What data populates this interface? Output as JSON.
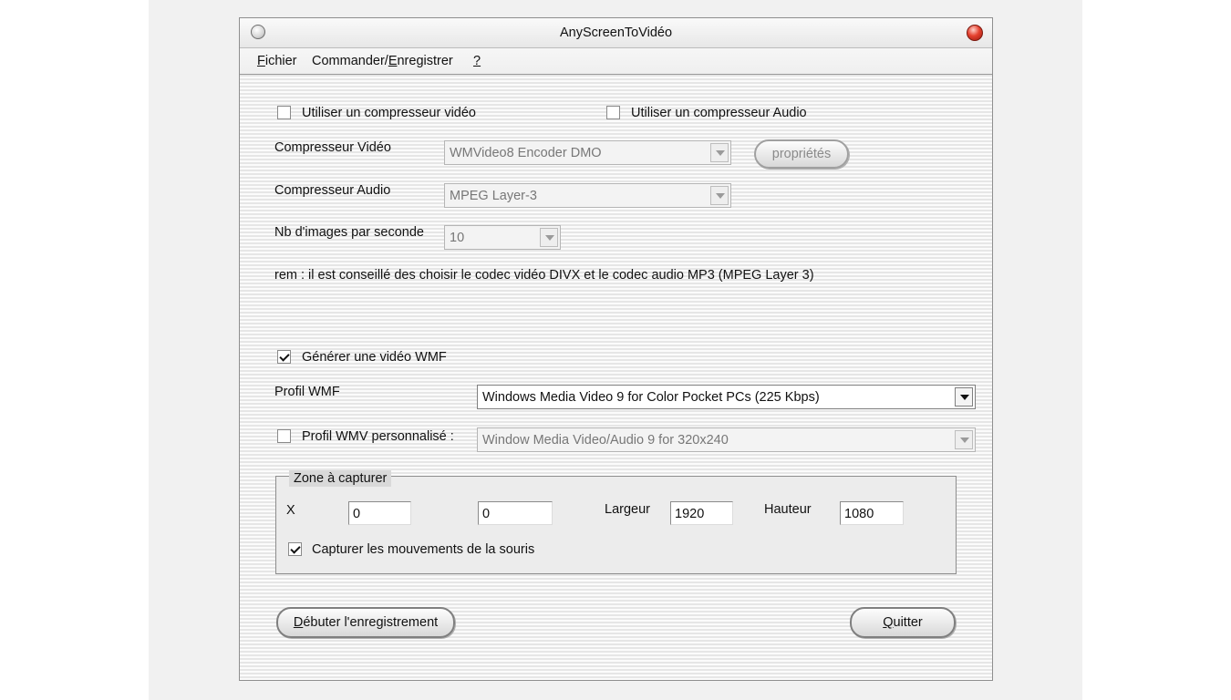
{
  "window": {
    "title": "AnyScreenToVidéo"
  },
  "menu": [
    {
      "before": "",
      "key": "F",
      "after": "ichier"
    },
    {
      "before": "Commander/",
      "key": "E",
      "after": "nregistrer"
    },
    {
      "before": "",
      "key": "?",
      "after": ""
    }
  ],
  "compression": {
    "use_video_compressor": {
      "label": "Utiliser un compresseur vidéo",
      "checked": false
    },
    "use_audio_compressor": {
      "label": "Utiliser un compresseur Audio",
      "checked": false
    },
    "video_compressor": {
      "label": "Compresseur Vidéo",
      "value": "WMVideo8 Encoder DMO"
    },
    "properties_button": "propriétés",
    "audio_compressor": {
      "label": "Compresseur Audio",
      "value": "MPEG Layer-3"
    },
    "fps": {
      "label": "Nb d'images par seconde",
      "value": "10"
    },
    "note": "rem : il est conseillé des choisir le codec vidéo DIVX et le codec audio MP3 (MPEG Layer 3)"
  },
  "wmf": {
    "generate": {
      "label": "Générer une vidéo WMF",
      "checked": true
    },
    "profile": {
      "label": "Profil WMF",
      "value": "Windows Media Video 9 for Color Pocket PCs (225 Kbps)"
    },
    "custom_profile": {
      "label": "Profil WMV personnalisé :",
      "checked": false,
      "value": "Window Media Video/Audio 9 for 320x240"
    }
  },
  "capture_zone": {
    "title": "Zone à capturer",
    "x_label": "X",
    "x_value": "0",
    "y_value": "0",
    "width_label": "Largeur",
    "width_value": "1920",
    "height_label": "Hauteur",
    "height_value": "1080",
    "mouse": {
      "label": "Capturer les mouvements de la souris",
      "checked": true
    }
  },
  "buttons": {
    "start": {
      "key": "D",
      "rest": "ébuter l'enregistrement"
    },
    "quit": {
      "key": "Q",
      "rest": "uitter"
    }
  }
}
